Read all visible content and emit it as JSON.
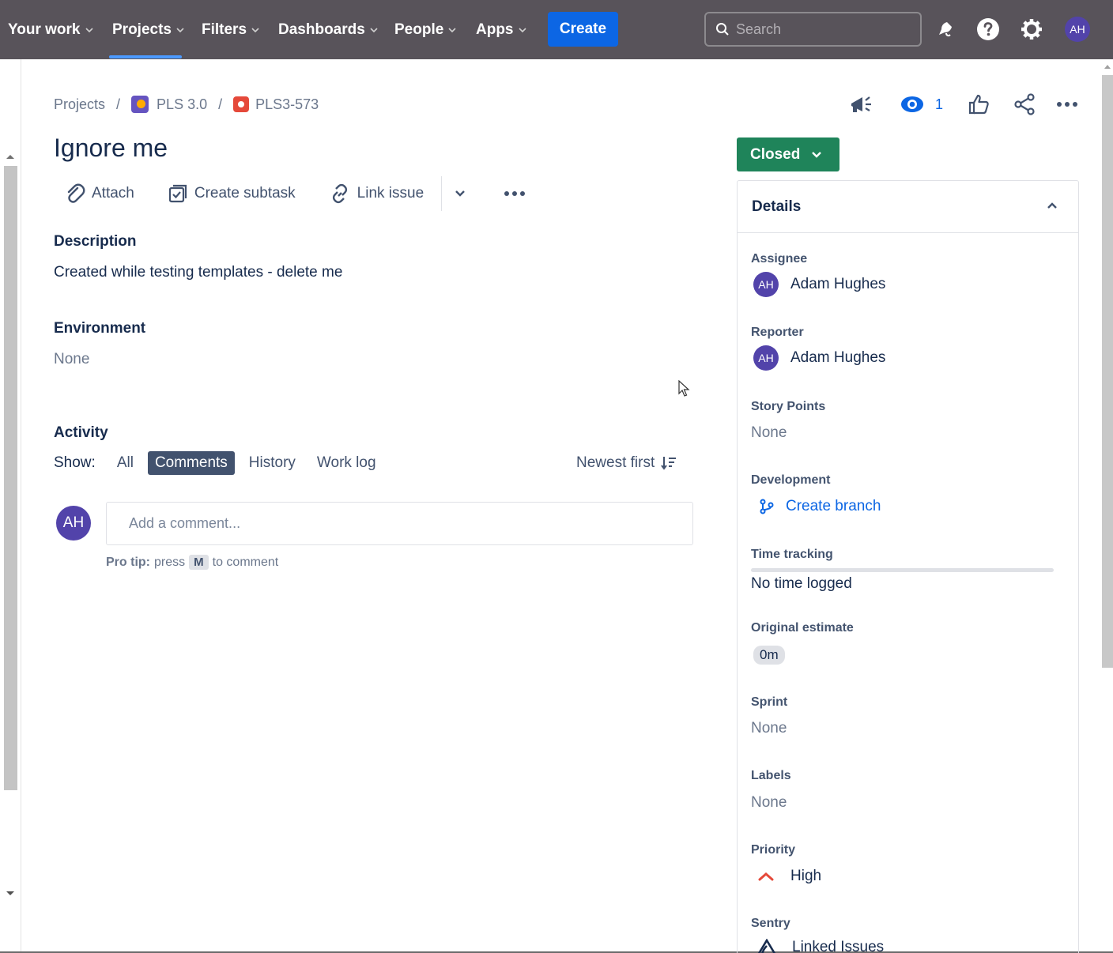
{
  "nav": {
    "items": [
      {
        "label": "Your work"
      },
      {
        "label": "Projects"
      },
      {
        "label": "Filters"
      },
      {
        "label": "Dashboards"
      },
      {
        "label": "People"
      },
      {
        "label": "Apps"
      }
    ],
    "create_label": "Create",
    "search_placeholder": "Search",
    "user_initials": "AH",
    "icons": [
      "notifications-icon",
      "help-icon",
      "settings-icon"
    ]
  },
  "breadcrumb": {
    "root": "Projects",
    "project": "PLS 3.0",
    "issue_key": "PLS3-573"
  },
  "issue_actions": {
    "watch_count": "1",
    "icons": [
      "feedback-icon",
      "watch-icon",
      "like-icon",
      "share-icon",
      "more-icon"
    ]
  },
  "issue": {
    "title": "Ignore me"
  },
  "toolbar": {
    "attach": "Attach",
    "create_subtask": "Create subtask",
    "link_issue": "Link issue"
  },
  "description": {
    "heading": "Description",
    "text": "Created while testing templates - delete me"
  },
  "environment": {
    "heading": "Environment",
    "value": "None"
  },
  "activity": {
    "heading": "Activity",
    "show_label": "Show:",
    "tabs": [
      "All",
      "Comments",
      "History",
      "Work log"
    ],
    "active_tab": "Comments",
    "sort_label": "Newest first",
    "comment_avatar": "AH",
    "comment_placeholder": "Add a comment...",
    "pro_tip_label": "Pro tip:",
    "pro_tip_press": "press",
    "pro_tip_key": "M",
    "pro_tip_suffix": "to comment"
  },
  "status": {
    "label": "Closed",
    "color": "#1f845a"
  },
  "details": {
    "heading": "Details",
    "assignee_label": "Assignee",
    "assignee_initials": "AH",
    "assignee_name": "Adam Hughes",
    "reporter_label": "Reporter",
    "reporter_initials": "AH",
    "reporter_name": "Adam Hughes",
    "story_points_label": "Story Points",
    "story_points_value": "None",
    "development_label": "Development",
    "development_value": "Create branch",
    "time_tracking_label": "Time tracking",
    "time_tracking_value": "No time logged",
    "original_estimate_label": "Original estimate",
    "original_estimate_value": "0m",
    "sprint_label": "Sprint",
    "sprint_value": "None",
    "labels_label": "Labels",
    "labels_value": "None",
    "priority_label": "Priority",
    "priority_value": "High",
    "sentry_label": "Sentry",
    "sentry_value": "Linked Issues"
  },
  "colors": {
    "nav_bg": "#58535a",
    "primary": "#0c66e4",
    "avatar": "#5243aa",
    "priority_high": "#e5493a"
  }
}
